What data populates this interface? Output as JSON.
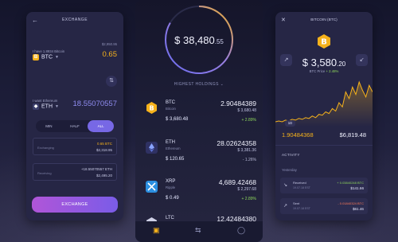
{
  "colors": {
    "accent": "#f6b21b",
    "positive": "#8dd65b",
    "primary": "#7768e5",
    "negative": "#ff7a59"
  },
  "exchange": {
    "title": "EXCHANGE",
    "back_icon": "arrow-left-icon",
    "have_label": "I have 1.8934 Bitcoin",
    "have_balance": "$2,950.95",
    "have_symbol": "BTC",
    "have_amount": "0.65",
    "want_label": "I want Ethereum",
    "want_balance": "$3,481.78",
    "want_symbol": "ETH",
    "want_amount": "18.55070557",
    "options": [
      "MIN",
      "HALF",
      "ALL"
    ],
    "active_option": "ALL",
    "exchanging_label": "Exchanging",
    "exchanging_value": "0.65 BTC",
    "exchanging_fiat": "$2,318.95",
    "receiving_label": "Receiving",
    "receiving_value": "+18.55070557 ETH",
    "receiving_fiat": "$2,495.20",
    "button": "EXCHANGE"
  },
  "portfolio": {
    "total_main": "$ 38,480",
    "total_cents": ".55",
    "section": "HIGHEST HOLDINGS",
    "holdings": [
      {
        "symbol": "BTC",
        "name": "Bitcoin",
        "amount": "2.90484389",
        "fiat": "$ 3,680.48",
        "price": "$ 3,680.48",
        "change": "+ 2.89%",
        "trend": "up",
        "icon": "bitcoin-icon"
      },
      {
        "symbol": "ETH",
        "name": "Ethereum",
        "amount": "28.02624358",
        "fiat": "$ 3,381.36",
        "price": "$ 120.65",
        "change": "- 1.26%",
        "trend": "down",
        "icon": "ethereum-icon"
      },
      {
        "symbol": "XRP",
        "name": "Ripple",
        "amount": "4,689.42468",
        "fiat": "$ 2,297.68",
        "price": "$ 0.49",
        "change": "+ 2.89%",
        "trend": "up",
        "icon": "ripple-icon"
      },
      {
        "symbol": "LTC",
        "name": "",
        "amount": "12.42484380",
        "fiat": "",
        "price": "",
        "change": "",
        "trend": "up",
        "icon": "litecoin-icon"
      }
    ],
    "tabs": [
      "wallet-icon",
      "transfer-icon",
      "profile-icon"
    ]
  },
  "detail": {
    "title": "BITCOIN (BTC)",
    "price_main": "$ 3,580",
    "price_cents": ".20",
    "sub_label": "BTC Price",
    "sub_change": "+ 2.48%",
    "range": "1D",
    "holding_amount": "1.90484368",
    "holding_fiat": "$6,819.48",
    "activity_title": "ACTIVITY",
    "day_label": "Yesterday",
    "transactions": [
      {
        "name": "Received",
        "date": "19.07.18 EST",
        "crypto": "+ 0.03840248 BTC",
        "fiat": "$141.66",
        "direction": "in"
      },
      {
        "name": "Sent",
        "date": "19.07.18 EST",
        "crypto": "- 0.01840324 BTC",
        "fiat": "$61.46",
        "direction": "out"
      }
    ],
    "chart_values": [
      22,
      23,
      22,
      24,
      23,
      25,
      24,
      26,
      25,
      27,
      26,
      29,
      27,
      31,
      30,
      34,
      32,
      38,
      35,
      45,
      40,
      58,
      50,
      64,
      55,
      70,
      60,
      52,
      66,
      58
    ]
  }
}
